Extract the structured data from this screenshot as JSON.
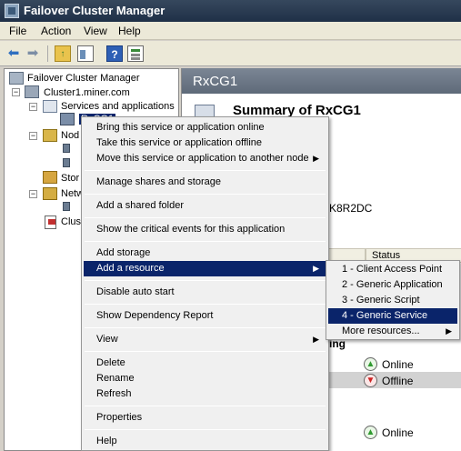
{
  "window": {
    "title": "Failover Cluster Manager"
  },
  "menubar": [
    "File",
    "Action",
    "View",
    "Help"
  ],
  "toolbar": {
    "back_icon": "arrow-left-icon",
    "forward_icon": "arrow-right-icon",
    "help_glyph": "?"
  },
  "tree": {
    "root": "Failover Cluster Manager",
    "cluster": "Cluster1.miner.com",
    "services": "Services and applications",
    "selected_item": "RxCG1",
    "nodes": "Nod",
    "storage": "Stor",
    "networks": "Netw",
    "events": "Clus"
  },
  "rightpane": {
    "header": "RxCG1",
    "summary_title": "Summary of RxCG1",
    "fragment_k8r2dc": "K8R2DC",
    "fragment_ing": "ing",
    "status_header": "Status",
    "statuses": [
      "Online",
      "Offline",
      "Online"
    ]
  },
  "context_menu": {
    "items": [
      "Bring this service or application online",
      "Take this service or application offline",
      "Move this service or application to another node",
      "Manage shares and storage",
      "Add a shared folder",
      "Show the critical events for this application",
      "Add storage",
      "Add a resource",
      "Disable auto start",
      "Show Dependency Report",
      "View",
      "Delete",
      "Rename",
      "Refresh",
      "Properties",
      "Help"
    ],
    "highlighted": "Add a resource"
  },
  "submenu": {
    "items": [
      "1 - Client Access Point",
      "2 - Generic Application",
      "3 - Generic Script",
      "4 - Generic Service",
      "More resources..."
    ],
    "highlighted": "4 - Generic Service"
  },
  "colors": {
    "titlebar": "#1f3047",
    "menu_highlight": "#0a246a",
    "pane_header": "#5e6a79"
  }
}
